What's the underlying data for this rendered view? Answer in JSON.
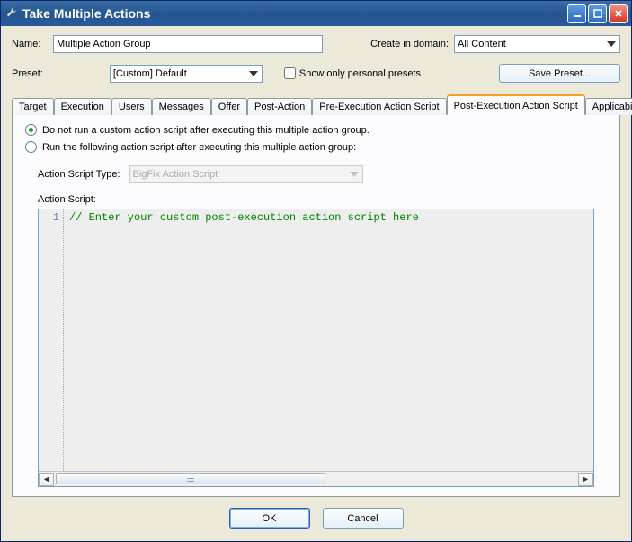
{
  "window": {
    "title": "Take Multiple Actions"
  },
  "header": {
    "name_label": "Name:",
    "name_value": "Multiple Action Group",
    "domain_label": "Create in domain:",
    "domain_value": "All Content"
  },
  "preset": {
    "label": "Preset:",
    "value": "[Custom] Default",
    "show_personal_label": "Show only personal presets",
    "save_button": "Save Preset..."
  },
  "tabs": [
    {
      "label": "Target"
    },
    {
      "label": "Execution"
    },
    {
      "label": "Users"
    },
    {
      "label": "Messages"
    },
    {
      "label": "Offer"
    },
    {
      "label": "Post-Action"
    },
    {
      "label": "Pre-Execution Action Script"
    },
    {
      "label": "Post-Execution Action Script"
    },
    {
      "label": "Applicability"
    }
  ],
  "panel": {
    "radio_no_script": "Do not run a custom action script after executing this multiple action group.",
    "radio_run_script": "Run the following action script after executing this multiple action group:",
    "script_type_label": "Action Script Type:",
    "script_type_value": "BigFix Action Script",
    "script_label": "Action Script:",
    "gutter_line": "1",
    "code_placeholder": "// Enter your custom post-execution action script here"
  },
  "buttons": {
    "ok": "OK",
    "cancel": "Cancel"
  }
}
